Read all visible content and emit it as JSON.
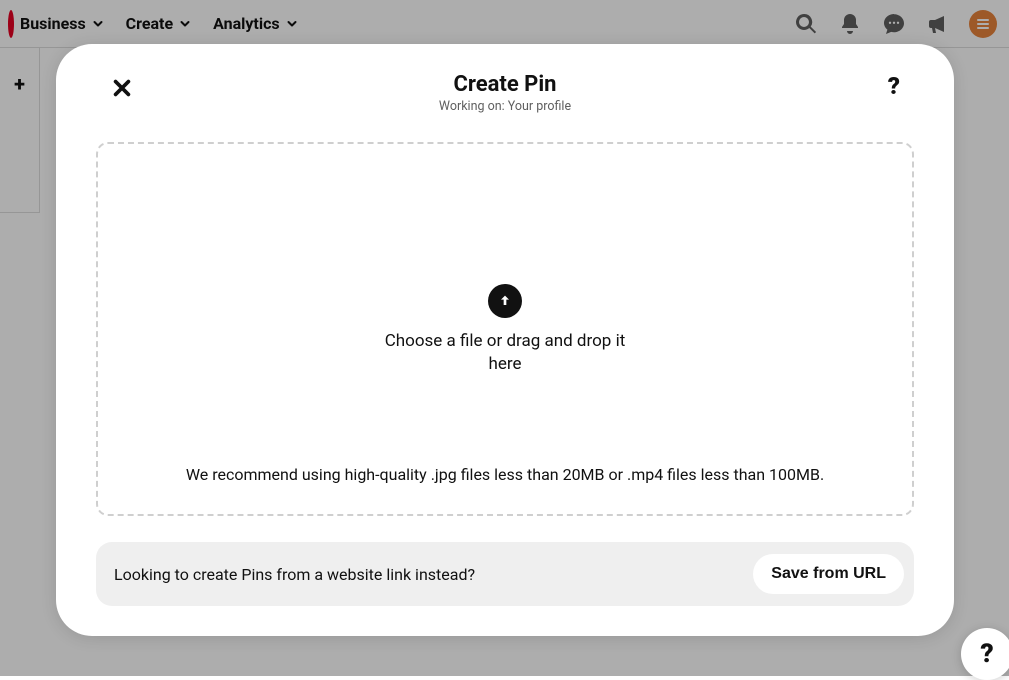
{
  "nav": {
    "items": [
      {
        "label": "Business"
      },
      {
        "label": "Create"
      },
      {
        "label": "Analytics"
      }
    ]
  },
  "modal": {
    "title": "Create Pin",
    "subtitle": "Working on: Your profile",
    "drop_text": "Choose a file or drag and drop it here",
    "recommend_text": "We recommend using high-quality .jpg files less than 20MB or .mp4 files less than 100MB.",
    "url_prompt": "Looking to create Pins from a website link instead?",
    "save_url_label": "Save from URL"
  }
}
